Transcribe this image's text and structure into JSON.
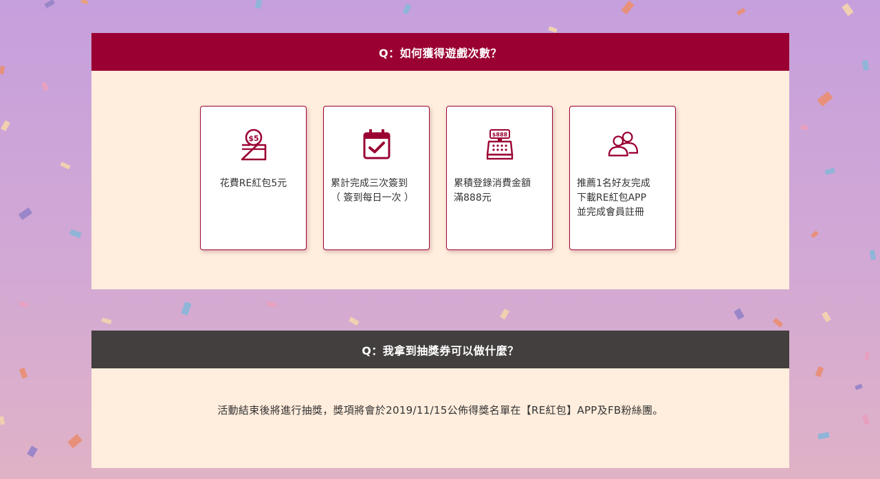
{
  "colors": {
    "header_red": "#9a0032",
    "header_dark": "#433f3e",
    "panel_bg": "#ffeddd",
    "accent": "#9a0032"
  },
  "sections": [
    {
      "question": "Q：如何獲得遊戲次數？",
      "cards": [
        {
          "icon": "coin-deposit-box-icon",
          "badge": "$5",
          "lines": [
            "花費RE紅包5元"
          ]
        },
        {
          "icon": "calendar-check-icon",
          "lines": [
            "累計完成三次簽到",
            "（ 簽到每日一次 ）"
          ]
        },
        {
          "icon": "cash-register-icon",
          "badge": "$888",
          "lines": [
            "累積登錄消費金額",
            "滿888元"
          ]
        },
        {
          "icon": "two-users-icon",
          "lines": [
            "推薦1名好友完成",
            "下載RE紅包APP",
            "並完成會員註冊"
          ]
        }
      ]
    },
    {
      "question": "Q：我拿到抽獎券可以做什麼？",
      "answer": "活動結束後將進行抽獎，獎項將會於2019/11/15公佈得獎名單在【RE紅包】APP及FB粉絲團。"
    }
  ]
}
